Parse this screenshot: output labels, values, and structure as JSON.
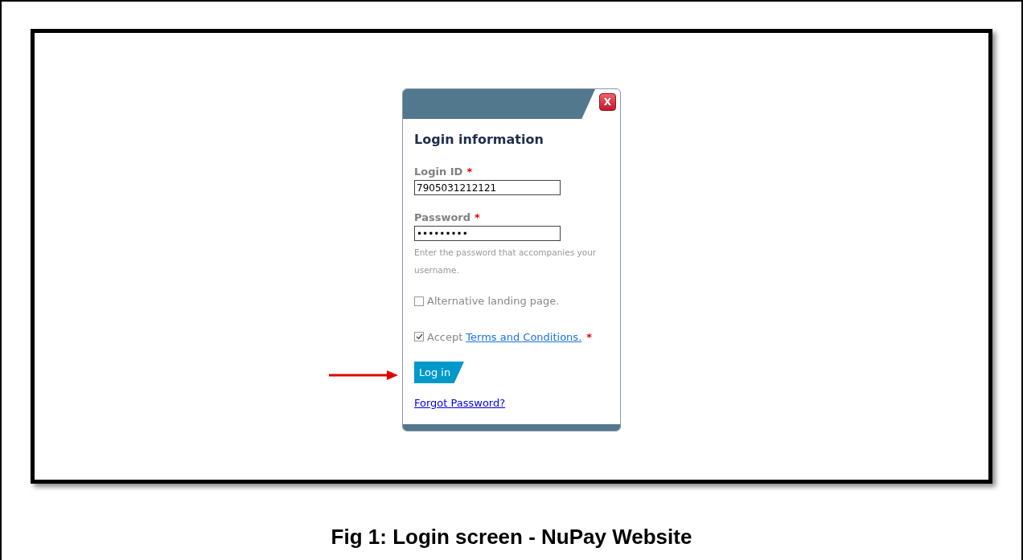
{
  "dialog": {
    "close_button": "X",
    "title": "Login information",
    "fields": [
      {
        "label": "Login ID",
        "required_mark": "*",
        "value": "7905031212121"
      },
      {
        "label": "Password",
        "required_mark": "*",
        "value": "•••••••••",
        "hint": "Enter the password that accompanies your username."
      }
    ],
    "checkboxes": [
      {
        "label": "Alternative landing page.",
        "checked": false
      },
      {
        "label": "Accept",
        "link": "Terms and Conditions.",
        "required_mark": "*",
        "checked": true
      }
    ],
    "login_button": "Log in",
    "forgot_link": "Forgot Password?"
  },
  "caption": "Fig 1: Login screen - NuPay Website"
}
